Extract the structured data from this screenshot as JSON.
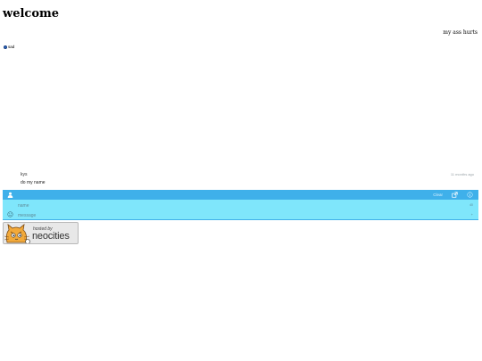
{
  "page": {
    "title": "welcome",
    "tagline": "my ass hurts"
  },
  "status": {
    "label": "sad",
    "icon": "status-dot-icon",
    "color": "#2a6cc8"
  },
  "chat": {
    "messages": [
      {
        "user": "kys",
        "time": "11 months ago",
        "text": "do my name"
      }
    ],
    "toolbar": {
      "clear_label": "Clear",
      "user_icon": "user-icon",
      "popout_icon": "external-link-icon",
      "info_icon": "info-icon",
      "bar_color": "#3fb0ea"
    },
    "inputs": {
      "name_placeholder": "name",
      "message_placeholder": "message",
      "char_count": "40",
      "send_mark": "+",
      "emoji_icon": "smiley-icon",
      "input_color": "#7fe6fb"
    }
  },
  "badge": {
    "hosted_by": "hosted by",
    "name": "neocities",
    "icon": "neocities-cat-logo"
  }
}
